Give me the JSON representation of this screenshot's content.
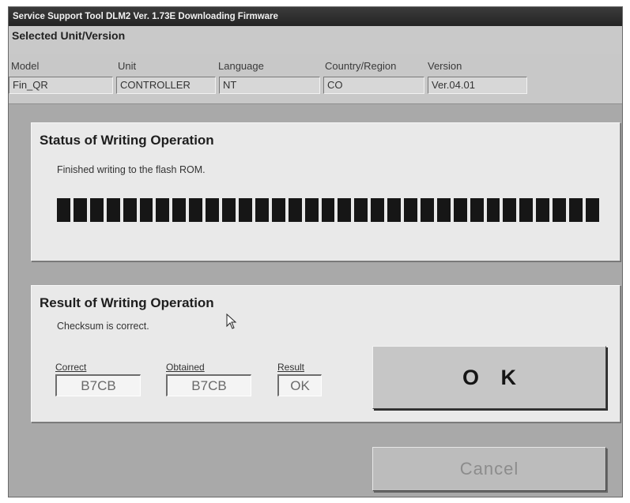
{
  "window": {
    "title": "Service Support Tool DLM2 Ver. 1.73E  Downloading Firmware"
  },
  "selected": {
    "title": "Selected Unit/Version",
    "columns": [
      {
        "label": "Model",
        "value": "Fin_QR"
      },
      {
        "label": "Unit",
        "value": "CONTROLLER"
      },
      {
        "label": "Language",
        "value": "NT"
      },
      {
        "label": "Country/Region",
        "value": "CO"
      },
      {
        "label": "Version",
        "value": "Ver.04.01"
      }
    ]
  },
  "status": {
    "title": "Status of Writing Operation",
    "message": "Finished writing to the flash ROM.",
    "progress_fraction": 1.0
  },
  "result": {
    "title": "Result of Writing Operation",
    "message": "Checksum is correct.",
    "correct_label": "Correct",
    "correct_value": "B7CB",
    "obtained_label": "Obtained",
    "obtained_value": "B7CB",
    "result_label": "Result",
    "result_value": "OK"
  },
  "buttons": {
    "ok_label": "O K",
    "cancel_label": "Cancel"
  },
  "colors": {
    "titlebar": "#2a2a2a",
    "background": "#a9a9a9",
    "panel": "#e9e9e9",
    "progress_block": "#161616"
  }
}
